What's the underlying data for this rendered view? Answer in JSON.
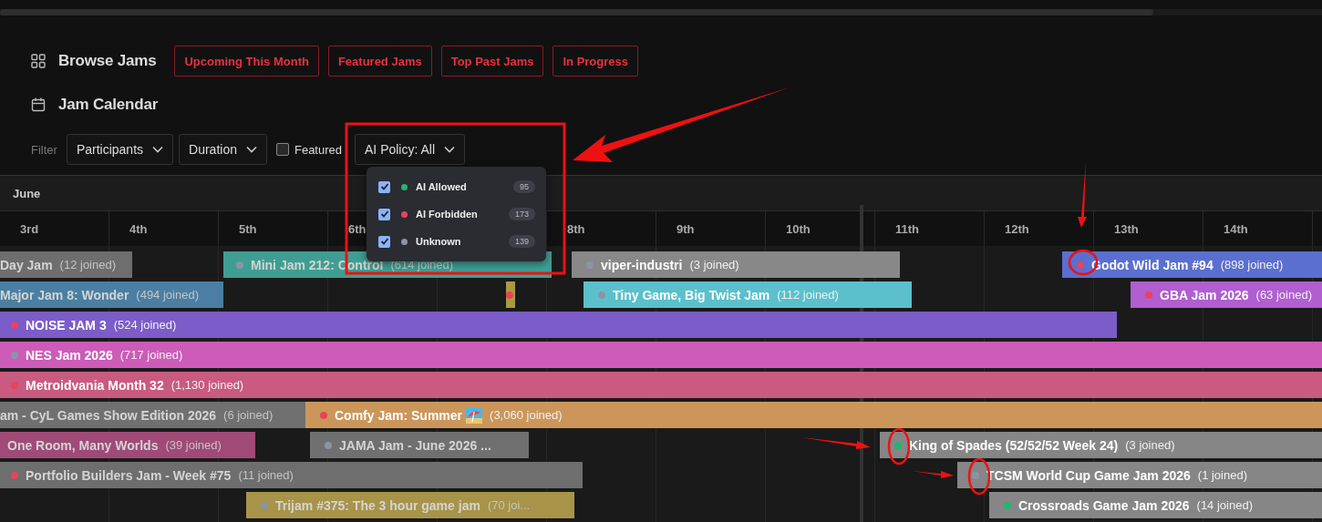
{
  "nav": {
    "title": "Browse Jams",
    "links": [
      {
        "label": "Upcoming This Month"
      },
      {
        "label": "Featured Jams"
      },
      {
        "label": "Top Past Jams"
      },
      {
        "label": "In Progress"
      }
    ]
  },
  "calendar": {
    "title": "Jam Calendar"
  },
  "filters": {
    "label": "Filter",
    "dropdowns": [
      {
        "label": "Participants"
      },
      {
        "label": "Duration"
      }
    ],
    "featured": {
      "label": "Featured",
      "checked": false
    },
    "ai_policy": {
      "label": "AI Policy: All",
      "options": [
        {
          "label": "AI Allowed",
          "checked": true,
          "color": "#22b573",
          "count": "95"
        },
        {
          "label": "AI Forbidden",
          "checked": true,
          "color": "#e8435a",
          "count": "173"
        },
        {
          "label": "Unknown",
          "checked": true,
          "color": "#8a94a8",
          "count": "139"
        }
      ]
    }
  },
  "month": "June",
  "days": [
    "3rd",
    "4th",
    "5th",
    "6th",
    "8th",
    "9th",
    "10th",
    "11th",
    "12th",
    "13th",
    "14th"
  ],
  "rows": [
    [
      {
        "name": "Day Jam",
        "joined": "(12 joined)",
        "color": "#6e6e6e",
        "ended": true
      },
      {
        "name": "Mini Jam 212: Control",
        "joined": "(614 joined)",
        "color": "#3f9e92",
        "ai": {
          "color": "#8a94a8"
        },
        "ended": true
      },
      {
        "name": "viper-industri",
        "joined": "(3 joined)",
        "color": "#888888",
        "ai": {
          "color": "#8a94a8"
        },
        "ended": false
      },
      {
        "name": "Godot Wild Jam #94",
        "joined": "(898 joined)",
        "color": "#5a6fcf",
        "ai": {
          "color": "#e8435a"
        },
        "ended": false
      }
    ],
    [
      {
        "name": "Major Jam 8: Wonder",
        "joined": "(494 joined)",
        "color": "#4a7fa3",
        "ended": true
      },
      {
        "color": "#a89a40",
        "ai": {
          "color": "#e8435a"
        }
      },
      {
        "name": "Tiny Game, Big Twist Jam",
        "joined": "(112 joined)",
        "color": "#5bc0cc",
        "ai": {
          "color": "#8a94a8"
        },
        "ended": false
      },
      {
        "name": "GBA Jam 2026",
        "joined": "(63 joined)",
        "color": "#b05ed0",
        "ai": {
          "color": "#e8435a"
        },
        "ended": false
      }
    ],
    [
      {
        "name": "NOISE JAM 3",
        "joined": "(524 joined)",
        "color": "#7b5cc9",
        "ai": {
          "color": "#e8435a"
        },
        "ended": false
      }
    ],
    [
      {
        "name": "NES Jam 2026",
        "joined": "(717 joined)",
        "color": "#cc5cb8",
        "ai": {
          "color": "#8a94a8"
        },
        "ended": false
      }
    ],
    [
      {
        "name": "Metroidvania Month 32",
        "joined": "(1,130 joined)",
        "color": "#c95a80",
        "ai": {
          "color": "#e8435a"
        },
        "ended": false
      }
    ],
    [
      {
        "name": "am - CyL Games Show Edition 2026",
        "joined": "(6 joined)",
        "color": "#707070",
        "ended": true
      },
      {
        "name": "Comfy Jam: Summer",
        "joined": "(3,060 joined)",
        "color": "#cc965a",
        "ai": {
          "color": "#e8435a"
        },
        "ended": false
      }
    ],
    [
      {
        "name": "One Room, Many Worlds",
        "joined": "(39 joined)",
        "color": "#a04a78",
        "ended": true
      },
      {
        "name": "JAMA Jam - June 2026 ...",
        "color": "#707070",
        "ai": {
          "color": "#8a94a8"
        },
        "ended": true
      },
      {
        "name": "King of Spades (52/52/52 Week 24)",
        "joined": "(3 joined)",
        "color": "#868686",
        "ai": {
          "color": "#22b573"
        },
        "ended": false
      }
    ],
    [
      {
        "name": "Portfolio Builders Jam - Week #75",
        "joined": "(11 joined)",
        "color": "#6e6e6e",
        "ai": {
          "color": "#e8435a"
        },
        "ended": true
      },
      {
        "name": "TCSM World Cup Game Jam 2026",
        "joined": "(1 joined)",
        "color": "#868686",
        "ai": {
          "color": "#8a94a8"
        },
        "ended": false
      }
    ],
    [
      {
        "name": "Trijam #375: The 3 hour game jam",
        "joined": "(70 joi...",
        "color": "#a89448",
        "ai": {
          "color": "#8a94a8"
        },
        "ended": true
      },
      {
        "name": "Crossroads Game Jam 2026",
        "joined": "(14 joined)",
        "color": "#868686",
        "ai": {
          "color": "#22b573"
        },
        "ended": false
      }
    ]
  ]
}
